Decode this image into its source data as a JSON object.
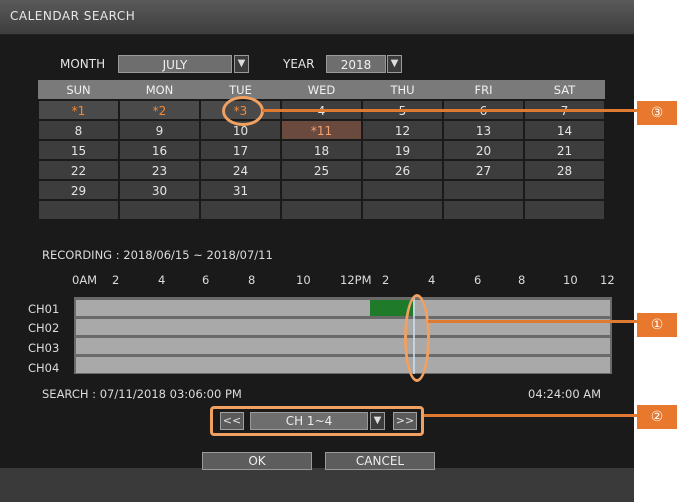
{
  "window": {
    "title": "CALENDAR SEARCH"
  },
  "month": {
    "label": "MONTH",
    "value": "JULY"
  },
  "year": {
    "label": "YEAR",
    "value": "2018"
  },
  "calendar": {
    "weekdays": [
      "SUN",
      "MON",
      "TUE",
      "WED",
      "THU",
      "FRI",
      "SAT"
    ],
    "weeks": [
      [
        "*1",
        "*2",
        "*3",
        "4",
        "5",
        "6",
        "7"
      ],
      [
        "8",
        "9",
        "10",
        "*11",
        "12",
        "13",
        "14"
      ],
      [
        "15",
        "16",
        "17",
        "18",
        "19",
        "20",
        "21"
      ],
      [
        "22",
        "23",
        "24",
        "25",
        "26",
        "27",
        "28"
      ],
      [
        "29",
        "30",
        "31",
        "",
        "",
        "",
        ""
      ],
      [
        "",
        "",
        "",
        "",
        "",
        "",
        ""
      ]
    ],
    "recorded_days": [
      "*1",
      "*2",
      "*3",
      "*11"
    ],
    "selected_day": "*11"
  },
  "recording": {
    "text": "RECORDING : 2018/06/15 ~ 2018/07/11"
  },
  "timeline": {
    "ticks": [
      "0AM",
      "2",
      "4",
      "6",
      "8",
      "10",
      "12PM",
      "2",
      "4",
      "6",
      "8",
      "10",
      "12"
    ],
    "channels": [
      "CH01",
      "CH02",
      "CH03",
      "CH04"
    ],
    "rec_color": "#1f7a2a",
    "bar_color": "#a9a9a9"
  },
  "search": {
    "text": "SEARCH : 07/11/2018 03:06:00 PM",
    "time": "04:24:00 AM"
  },
  "channel_nav": {
    "prev": "<<",
    "value": "CH 1~4",
    "next": ">>"
  },
  "buttons": {
    "ok": "OK",
    "cancel": "CANCEL"
  },
  "callouts": [
    "①",
    "②",
    "③"
  ],
  "colors": {
    "accent": "#e8782e"
  }
}
